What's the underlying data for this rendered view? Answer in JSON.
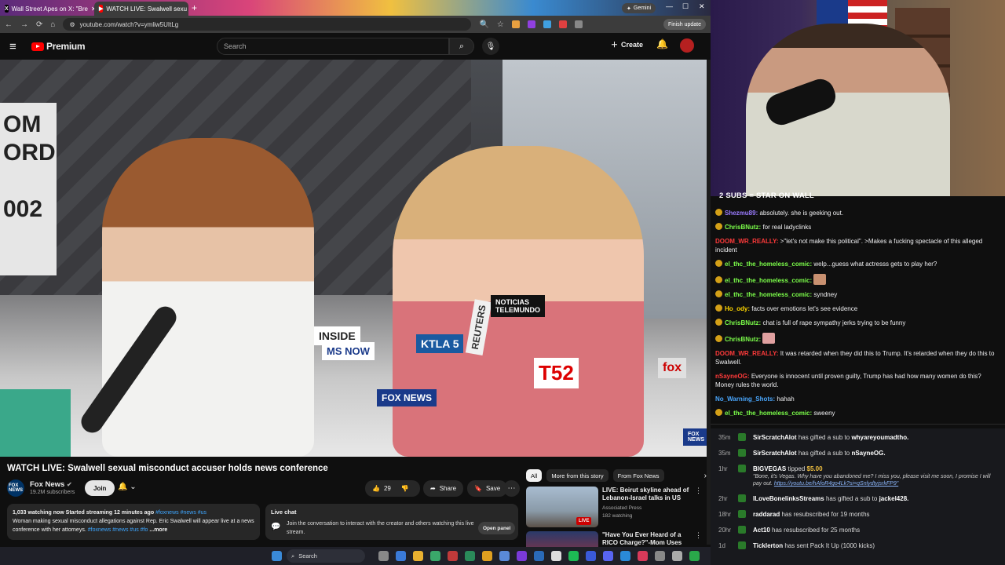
{
  "browser": {
    "tabs": [
      {
        "label": "Wall Street Apes on X: \"Bre",
        "active": false
      },
      {
        "label": "WATCH LIVE: Swalwell sexu",
        "active": true
      }
    ],
    "new_tab": "+",
    "gemini": "Gemini",
    "url": "youtube.com/watch?v=ymliw5UItLg",
    "finish_update": "Finish update"
  },
  "youtube": {
    "logo": "Premium",
    "search_placeholder": "Search",
    "create_label": "Create",
    "video_title": "WATCH LIVE: Swalwell sexual misconduct accuser holds news conference",
    "channel_name": "Fox News",
    "subscribers": "19.2M subscribers",
    "join_label": "Join",
    "likes": "29",
    "share_label": "Share",
    "save_label": "Save",
    "description": {
      "stats": "1,033 watching now  Started streaming 12 minutes ago",
      "stats_tags": "#foxnews #news #us",
      "text": "Woman making sexual misconduct allegations against Rep. Eric Swalwell will appear live at a news conference with her attorneys.",
      "tags": "#foxnews #news #us #fo",
      "more": "...more"
    },
    "live_chat": {
      "title": "Live chat",
      "text": "Join the conversation to interact with the creator and others watching this live stream.",
      "open_panel": "Open panel"
    },
    "chips": [
      "All",
      "More from this story",
      "From Fox News"
    ],
    "recommendations": [
      {
        "title": "LIVE: Beirut skyline ahead of Lebanon-Israel talks in US",
        "channel": "Associated Press",
        "meta": "182 watching",
        "badge": "LIVE"
      },
      {
        "title": "\"Have You Ever Heard of a RICO Charge?\"-Mom Uses Her Kids",
        "channel": "",
        "meta": "",
        "badge": ""
      }
    ],
    "video_overlay": {
      "sign_text": "OM\nORD\n002",
      "mic_labels": [
        "INSIDE",
        "MS NOW",
        "KTLA 5",
        "REUTERS",
        "NOTICIAS TELEMUNDO",
        "T 52",
        "FOX NEWS",
        "FOX NEWS"
      ]
    }
  },
  "taskbar": {
    "search": "Search"
  },
  "stream_overlay": {
    "sub_goal": "2 SUBS = STAR ON WALL"
  },
  "chat": [
    {
      "user": "Shezmu89:",
      "text": "absolutely. she is geeking out.",
      "color": "#9b7cff",
      "emote": false
    },
    {
      "user": "ChrisBNutz:",
      "text": "for real ladyclinks",
      "color": "#7cff4a",
      "emote": false
    },
    {
      "user": "DOOM_WR_REALLY:",
      "text": ">\"let's not make this political\". >Makes a fucking spectacle of this alleged incident",
      "color": "#ff3a3a",
      "emote": false
    },
    {
      "user": "el_thc_the_homeless_comic:",
      "text": "welp...guess what actresss gets to play her?",
      "color": "#7cff4a",
      "emote": false
    },
    {
      "user": "el_thc_the_homeless_comic:",
      "text": "",
      "color": "#7cff4a",
      "emote": true
    },
    {
      "user": "el_thc_the_homeless_comic:",
      "text": "syndney",
      "color": "#7cff4a",
      "emote": false
    },
    {
      "user": "Ho_ody:",
      "text": "facts over emotions let's see evidence",
      "color": "#ffd700",
      "emote": false
    },
    {
      "user": "ChrisBNutz:",
      "text": "chat is full of rape sympathy jerks trying to be funny",
      "color": "#7cff4a",
      "emote": false
    },
    {
      "user": "ChrisBNutz:",
      "text": "",
      "color": "#7cff4a",
      "emote": true
    },
    {
      "user": "DOOM_WR_REALLY:",
      "text": "It was retarded when they did this to Trump. It's retarded when they do this to Swalwell.",
      "color": "#ff3a3a",
      "emote": false
    },
    {
      "user": "nSayneOG:",
      "text": "Everyone is innocent until proven guilty, Trump has had how many women do this? Money rules the world.",
      "color": "#ff3a3a",
      "emote": false
    },
    {
      "user": "No_Warning_Shots:",
      "text": "hahah",
      "color": "#4aa8ff",
      "emote": false
    },
    {
      "user": "el_thc_the_homeless_comic:",
      "text": "sweeny",
      "color": "#7cff4a",
      "emote": false
    }
  ],
  "events": [
    {
      "time": "35m",
      "user": "SirScratchAlot",
      "text": "has gifted a sub to",
      "target": "whyareyoumadtho."
    },
    {
      "time": "35m",
      "user": "SirScratchAlot",
      "text": "has gifted a sub to",
      "target": "nSayneOG."
    },
    {
      "time": "1hr",
      "user": "BIGVEGAS",
      "text": "tipped",
      "target": "$5.00",
      "note": "\"Bone, it's Vegas. Why have you abandoned me? I miss you, please visit me soon, I promise I will pay out.",
      "link": "https://youtu.be/hAfoR4go4Lk?si=qSnlydtyjsrkFP9\""
    },
    {
      "time": "2hr",
      "user": "ILoveBonelinksStreams",
      "text": "has gifted a sub to",
      "target": "jackel428."
    },
    {
      "time": "18hr",
      "user": "raddarad",
      "text": "has resubscribed for 19 months",
      "target": ""
    },
    {
      "time": "20hr",
      "user": "Act10",
      "text": "has resubscribed for 25 months",
      "target": ""
    },
    {
      "time": "1d",
      "user": "Ticklerton",
      "text": "has sent Pack It Up (1000 kicks)",
      "target": ""
    }
  ]
}
